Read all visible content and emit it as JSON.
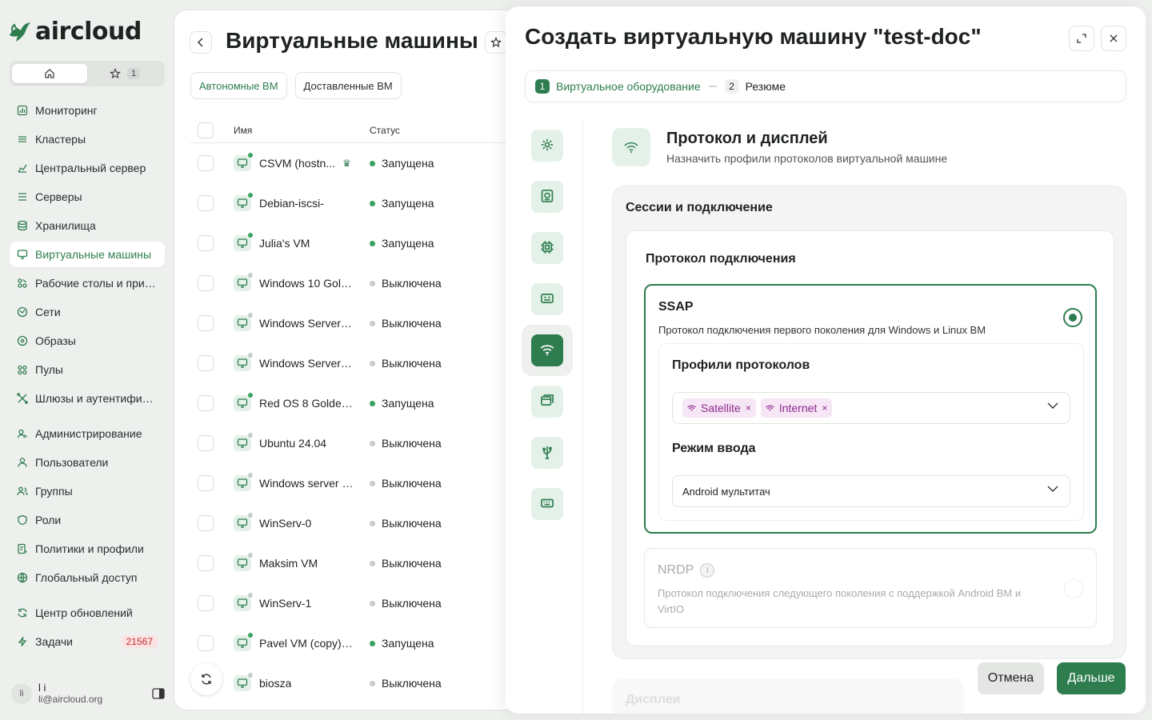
{
  "brand": {
    "name": "aircloud",
    "accent": "#2e7d4f"
  },
  "sidebar": {
    "favorites_count": "1",
    "items": [
      {
        "label": "Мониторинг",
        "icon": "chart-icon"
      },
      {
        "label": "Кластеры",
        "icon": "layers-icon"
      },
      {
        "label": "Центральный сервер",
        "icon": "hierarchy-icon"
      },
      {
        "label": "Серверы",
        "icon": "server-icon"
      },
      {
        "label": "Хранилища",
        "icon": "database-icon"
      },
      {
        "label": "Виртуальные машины",
        "icon": "monitor-icon",
        "active": true
      },
      {
        "label": "Рабочие столы и прил...",
        "icon": "apps-icon"
      },
      {
        "label": "Сети",
        "icon": "network-icon"
      },
      {
        "label": "Образы",
        "icon": "disc-icon"
      },
      {
        "label": "Пулы",
        "icon": "pool-icon"
      },
      {
        "label": "Шлюзы и аутентифика...",
        "icon": "gateway-icon"
      },
      {
        "label": "Администрирование",
        "icon": "admin-icon"
      },
      {
        "label": "Пользователи",
        "icon": "user-icon"
      },
      {
        "label": "Группы",
        "icon": "group-icon"
      },
      {
        "label": "Роли",
        "icon": "shield-icon"
      },
      {
        "label": "Политики и профили",
        "icon": "policy-icon"
      },
      {
        "label": "Глобальный доступ",
        "icon": "globe-icon"
      },
      {
        "label": "Центр обновлений",
        "icon": "refresh-icon"
      },
      {
        "label": "Задачи",
        "icon": "bolt-icon",
        "badge": "21567"
      }
    ],
    "user": {
      "initials": "li",
      "name": "l i",
      "email": "li@aircloud.org"
    }
  },
  "vm_list": {
    "title": "Виртуальные машины",
    "tabs": [
      "Автономные ВМ",
      "Доставленные ВМ"
    ],
    "columns": {
      "name": "Имя",
      "status": "Статус"
    },
    "rows": [
      {
        "name": "CSVM (hostn...",
        "status": "Запущена",
        "running": true,
        "extra": "crown"
      },
      {
        "name": "Debian-iscsi-",
        "status": "Запущена",
        "running": true
      },
      {
        "name": "Julia's VM",
        "status": "Запущена",
        "running": true
      },
      {
        "name": "Windows 10 Gold...",
        "status": "Выключена",
        "running": false
      },
      {
        "name": "Windows Server 2...",
        "status": "Выключена",
        "running": false
      },
      {
        "name": "Windows Server 2...",
        "status": "Выключена",
        "running": false
      },
      {
        "name": "Red OS 8 Golden ...",
        "status": "Запущена",
        "running": true
      },
      {
        "name": "Ubuntu 24.04",
        "status": "Выключена",
        "running": false
      },
      {
        "name": "Windows server f...",
        "status": "Выключена",
        "running": false
      },
      {
        "name": "WinServ-0",
        "status": "Выключена",
        "running": false
      },
      {
        "name": "Maksim VM",
        "status": "Выключена",
        "running": false
      },
      {
        "name": "WinServ-1",
        "status": "Выключена",
        "running": false
      },
      {
        "name": "Pavel VM (copy) de",
        "status": "Запущена",
        "running": true
      },
      {
        "name": "biosza",
        "status": "Выключена",
        "running": false
      }
    ]
  },
  "dialog": {
    "title": "Создать виртуальную машину \"test-doc\"",
    "steps": [
      {
        "num": "1",
        "label": "Виртуальное оборудование",
        "active": true
      },
      {
        "num": "2",
        "label": "Резюме",
        "active": false
      }
    ],
    "rail_icons": [
      "gear-icon",
      "disk-icon",
      "cpu-icon",
      "memory-icon",
      "wifi-icon",
      "window-icon",
      "usb-icon",
      "keyboard-icon"
    ],
    "rail_active_index": 4,
    "section": {
      "title": "Протокол и дисплей",
      "subtitle": "Назначить профили протоколов виртуальной машине"
    },
    "sessions": {
      "title": "Сессии и подключение",
      "protocol_title": "Протокол подключения",
      "ssap": {
        "name": "SSAP",
        "desc": "Протокол подключения первого поколения для Windows и Linux ВМ",
        "profiles_title": "Профили протоколов",
        "profiles": [
          "Satellite",
          "Internet"
        ],
        "input_mode_title": "Режим ввода",
        "input_mode_value": "Android мультитач"
      },
      "nrdp": {
        "name": "NRDP",
        "desc": "Протокол подключения следующего поколения с поддержкой Android ВМ и VirtIO"
      }
    },
    "next_section_title": "Дисплеи",
    "buttons": {
      "cancel": "Отмена",
      "next": "Дальше"
    }
  }
}
